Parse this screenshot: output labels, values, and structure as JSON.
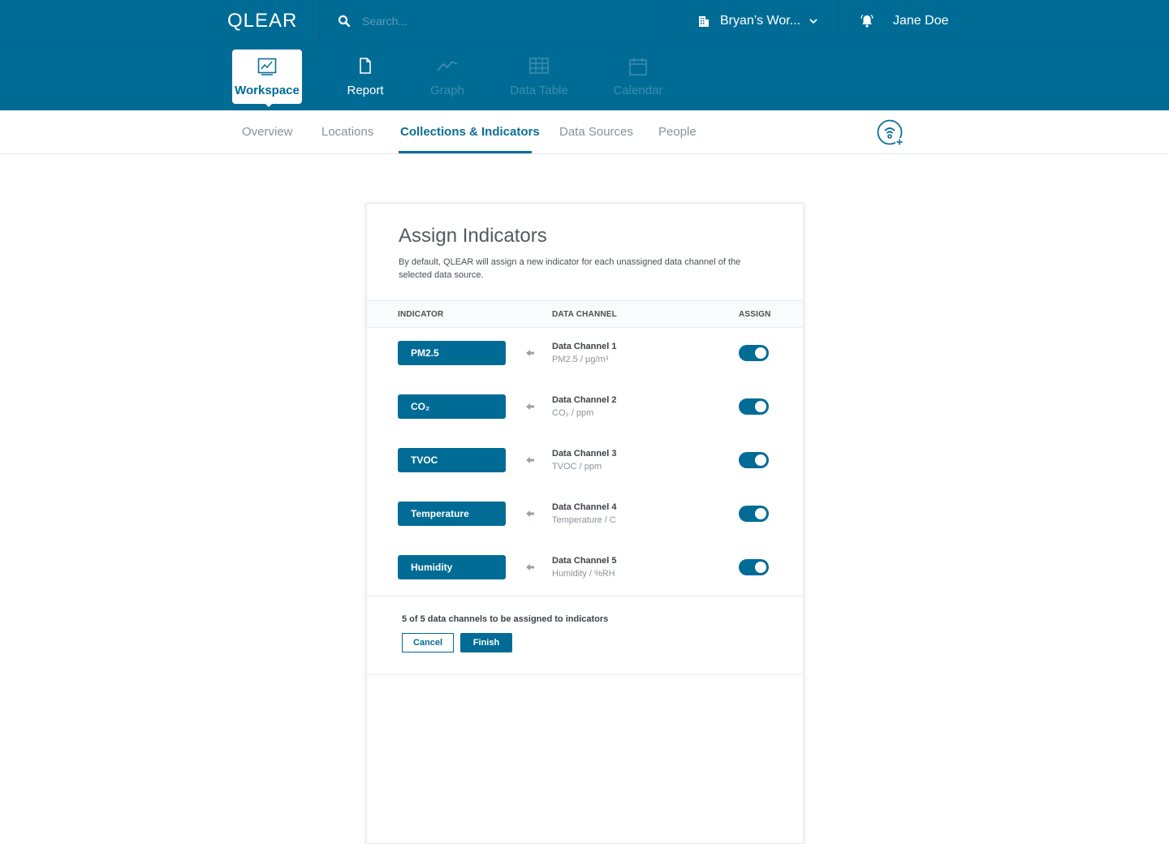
{
  "app": {
    "logo": "QLEAR",
    "search": {
      "placeholder": "Search..."
    },
    "workspace_selector": {
      "label": "Bryan’s Wor..."
    },
    "user": {
      "name": "Jane Doe"
    }
  },
  "modules": [
    {
      "label": "Workspace",
      "icon": "workspace-chart-icon",
      "state": "active"
    },
    {
      "label": "Report",
      "icon": "document-icon",
      "state": "normal"
    },
    {
      "label": "Graph",
      "icon": "line-graph-icon",
      "state": "disabled"
    },
    {
      "label": "Data Table",
      "icon": "table-grid-icon",
      "state": "disabled"
    },
    {
      "label": "Calendar",
      "icon": "calendar-icon",
      "state": "disabled"
    }
  ],
  "subnav": {
    "tabs": [
      {
        "label": "Overview",
        "active": false
      },
      {
        "label": "Locations",
        "active": false
      },
      {
        "label": "Collections & Indicators",
        "active": true
      },
      {
        "label": "Data Sources",
        "active": false
      },
      {
        "label": "People",
        "active": false
      }
    ],
    "action_icon": "add-data-source-icon"
  },
  "modal": {
    "title": "Assign Indicators",
    "description": "By default, QLEAR will assign a new indicator for each unassigned data channel of the selected data source.",
    "columns": {
      "indicator": "INDICATOR",
      "channel": "DATA CHANNEL",
      "assign": "ASSIGN"
    },
    "rows": [
      {
        "indicator": "PM2.5",
        "channel": "Data Channel 1",
        "unit": "PM2.5 / µg/m³",
        "assigned": true
      },
      {
        "indicator": "CO₂",
        "channel": "Data Channel 2",
        "unit": "CO₂ / ppm",
        "assigned": true
      },
      {
        "indicator": "TVOC",
        "channel": "Data Channel 3",
        "unit": "TVOC / ppm",
        "assigned": true
      },
      {
        "indicator": "Temperature",
        "channel": "Data Channel 4",
        "unit": "Temperature / C",
        "assigned": true
      },
      {
        "indicator": "Humidity",
        "channel": "Data Channel 5",
        "unit": "Humidity / %RH",
        "assigned": true
      }
    ],
    "summary": "5 of 5 data channels to be assigned to indicators",
    "cancel_label": "Cancel",
    "finish_label": "Finish"
  },
  "colors": {
    "brand": "#006c96",
    "subnav_active": "#0b6e98",
    "text_muted": "#8a9299"
  }
}
